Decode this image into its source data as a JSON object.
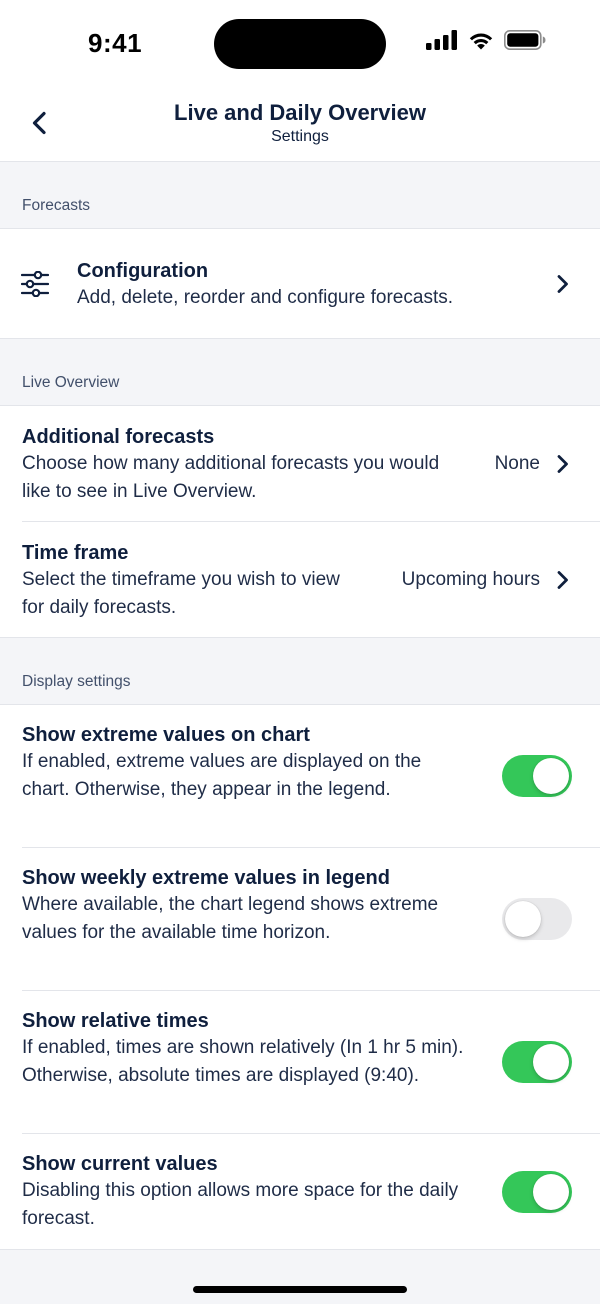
{
  "status_bar": {
    "time": "9:41"
  },
  "header": {
    "title": "Live and Daily Overview",
    "subtitle": "Settings"
  },
  "sections": {
    "forecasts": {
      "label": "Forecasts",
      "configuration": {
        "icon": "sliders-icon",
        "title": "Configuration",
        "description": "Add, delete, reorder and configure forecasts."
      }
    },
    "live_overview": {
      "label": "Live Overview",
      "additional_forecasts": {
        "title": "Additional forecasts",
        "description": "Choose how many additional forecasts you would like to see in Live Overview.",
        "value": "None"
      },
      "time_frame": {
        "title": "Time frame",
        "description": "Select the timeframe you wish to view for daily forecasts.",
        "value": "Upcoming hours"
      }
    },
    "display_settings": {
      "label": "Display settings",
      "items": [
        {
          "title": "Show extreme values on chart",
          "description": "If enabled, extreme values are displayed on the chart. Otherwise, they appear in the legend.",
          "enabled": true
        },
        {
          "title": "Show weekly extreme values in legend",
          "description": "Where available, the chart legend shows extreme values for the available time horizon.",
          "enabled": false
        },
        {
          "title": "Show relative times",
          "description": "If enabled, times are shown relatively (In 1 hr 5 min). Otherwise, absolute times are displayed (9:40).",
          "enabled": true
        },
        {
          "title": "Show current values",
          "description": "Disabling this option allows more space for the daily forecast.",
          "enabled": true
        }
      ]
    }
  },
  "colors": {
    "accent_on": "#34c759",
    "toggle_off": "#e9e9eb",
    "text_primary": "#0f1f3d",
    "background": "#f4f5f8"
  }
}
